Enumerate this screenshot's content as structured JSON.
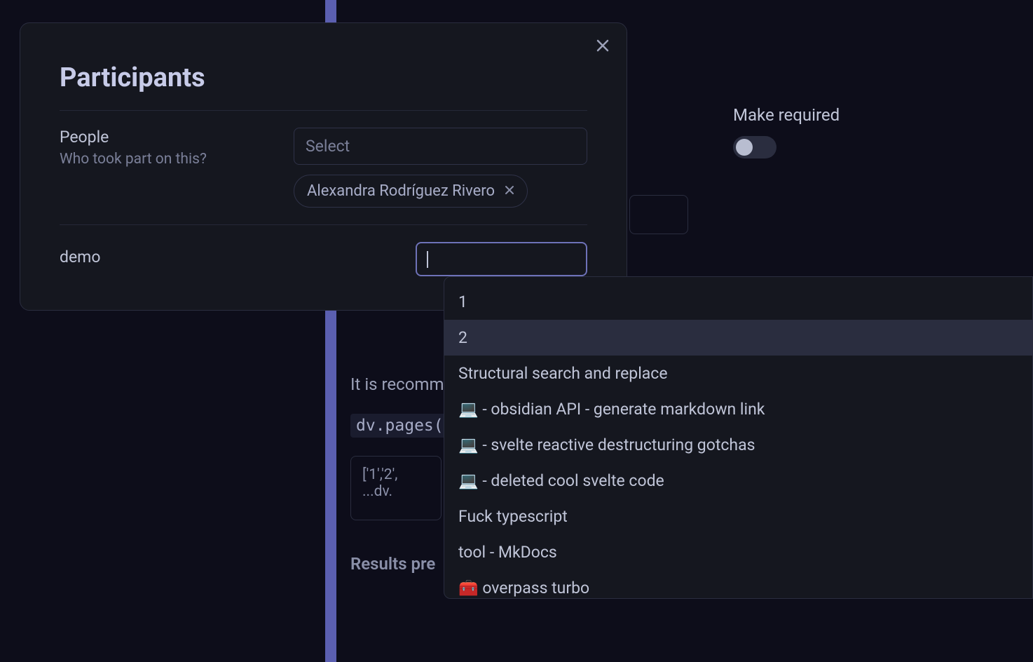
{
  "modal": {
    "title": "Participants",
    "people": {
      "label": "People",
      "sublabel": "Who took part on this?",
      "select_placeholder": "Select",
      "chips": [
        {
          "name": "Alexandra Rodríguez Rivero"
        }
      ]
    },
    "demo": {
      "label": "demo",
      "value": ""
    }
  },
  "background": {
    "required_label": "Make required",
    "recommend_text": "It is recomm",
    "code_snippet": "dv.pages(",
    "code_box": "['1','2', ...dv.",
    "results_label": "Results pre"
  },
  "dropdown": {
    "items": [
      {
        "text": "1",
        "highlighted": false
      },
      {
        "text": "2",
        "highlighted": true
      },
      {
        "text": "Structural search and replace",
        "highlighted": false
      },
      {
        "text": "💻 - obsidian API - generate markdown link",
        "highlighted": false
      },
      {
        "text": "💻 - svelte reactive destructuring gotchas",
        "highlighted": false
      },
      {
        "text": "💻 - deleted cool svelte code",
        "highlighted": false
      },
      {
        "text": "Fuck typescript",
        "highlighted": false
      },
      {
        "text": "tool - MkDocs",
        "highlighted": false
      },
      {
        "text": "🧰 overpass turbo",
        "highlighted": false
      }
    ]
  }
}
